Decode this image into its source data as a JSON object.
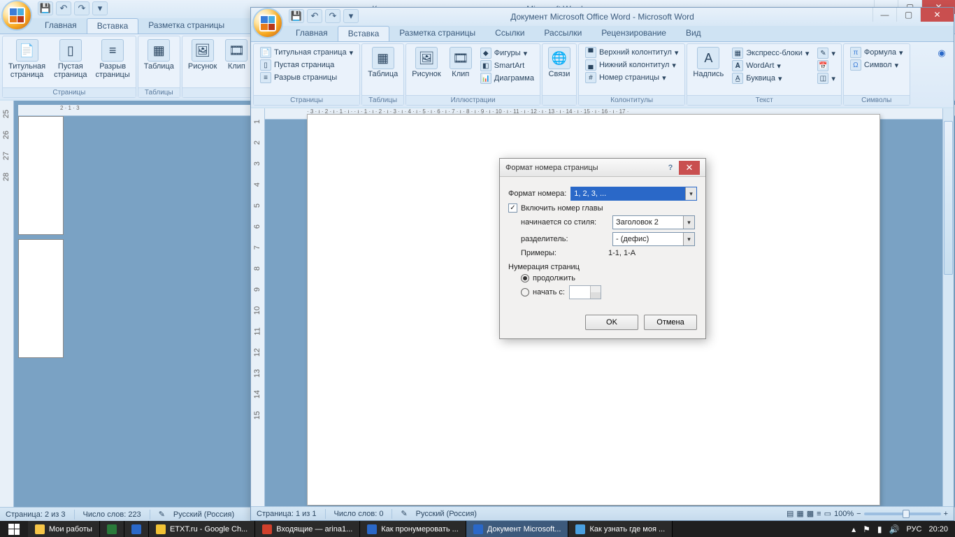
{
  "back": {
    "title": "Как пронумеровать страницы в ворде - Microsoft Word",
    "tabs": [
      "Главная",
      "Вставка",
      "Разметка страницы"
    ],
    "groups": {
      "pages": {
        "title": "Страницы",
        "cover": "Титульная\nстраница",
        "blank": "Пустая\nстраница",
        "break": "Разрыв\nстраницы"
      },
      "tables": {
        "title": "Таблицы",
        "table": "Таблица"
      },
      "illus": {
        "title": "",
        "picture": "Рисунок",
        "clip": "Клип"
      }
    },
    "status": {
      "page": "Страница: 2 из 3",
      "words": "Число слов: 223",
      "lang": "Русский (Россия)"
    }
  },
  "front": {
    "title": "Документ Microsoft Office Word - Microsoft Word",
    "tabs": [
      "Главная",
      "Вставка",
      "Разметка страницы",
      "Ссылки",
      "Рассылки",
      "Рецензирование",
      "Вид"
    ],
    "pages": {
      "title": "Страницы",
      "cover": "Титульная страница",
      "blank": "Пустая страница",
      "break": "Разрыв страницы"
    },
    "tables": {
      "title": "Таблицы",
      "table": "Таблица"
    },
    "illus": {
      "title": "Иллюстрации",
      "picture": "Рисунок",
      "clip": "Клип",
      "shapes": "Фигуры",
      "smartart": "SmartArt",
      "chart": "Диаграмма"
    },
    "links": {
      "title": "",
      "links_btn": "Связи"
    },
    "hf": {
      "title": "Колонтитулы",
      "header": "Верхний колонтитул",
      "footer": "Нижний колонтитул",
      "pagenum": "Номер страницы"
    },
    "text": {
      "title": "Текст",
      "textbox": "Надпись",
      "quick": "Экспресс-блоки",
      "wordart": "WordArt",
      "dropcap": "Буквица"
    },
    "sym": {
      "title": "Символы",
      "formula": "Формула",
      "symbol": "Символ"
    },
    "status": {
      "page": "Страница: 1 из 1",
      "words": "Число слов: 0",
      "lang": "Русский (Россия)",
      "zoom": "100%"
    }
  },
  "dlg": {
    "title": "Формат номера страницы",
    "format_lbl": "Формат номера:",
    "format_val": "1, 2, 3, ...",
    "include_chapter": "Включить номер главы",
    "starts_style": "начинается со стиля:",
    "style_val": "Заголовок 2",
    "separator": "разделитель:",
    "sep_val": "-   (дефис)",
    "examples": "Примеры:",
    "examples_val": "1-1, 1-A",
    "numbering": "Нумерация страниц",
    "continue": "продолжить",
    "start_at": "начать с:",
    "ok": "OK",
    "cancel": "Отмена"
  },
  "taskbar": {
    "items": [
      {
        "label": "Мои работы",
        "color": "#f7c648"
      },
      {
        "label": "",
        "color": "#2a7a3a"
      },
      {
        "label": "",
        "color": "#2a68c8"
      },
      {
        "label": "ETXT.ru - Google Ch...",
        "color": "#f2c335"
      },
      {
        "label": "Входящие — arina1...",
        "color": "#d0402c"
      },
      {
        "label": "Как пронумеровать ...",
        "color": "#2a68c8"
      },
      {
        "label": "Документ Microsoft...",
        "color": "#2a68c8",
        "active": true
      },
      {
        "label": "Как узнать где моя ...",
        "color": "#4aa0e0"
      }
    ],
    "lang": "РУС",
    "time": "20:20"
  }
}
